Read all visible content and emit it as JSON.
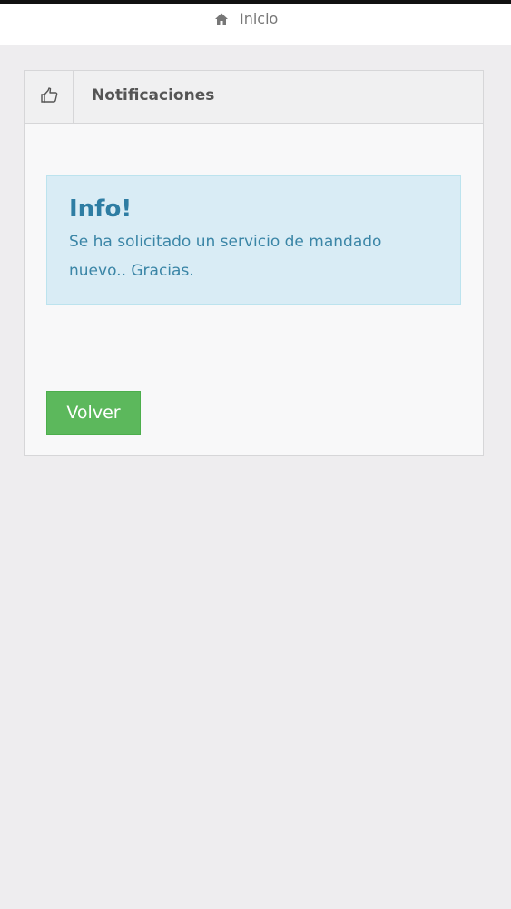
{
  "breadcrumb": {
    "icon": "home-icon",
    "label": "Inicio"
  },
  "panel": {
    "icon": "thumbs-up-icon",
    "title": "Notificaciones"
  },
  "alert": {
    "title": "Info!",
    "message": "Se ha solicitado un servicio de mandado nuevo.. Gracias."
  },
  "actions": {
    "back_label": "Volver"
  },
  "colors": {
    "background": "#eeedef",
    "alert_background": "#d9ecf5",
    "alert_text": "#2e7da3",
    "button_success": "#5cb85c"
  }
}
